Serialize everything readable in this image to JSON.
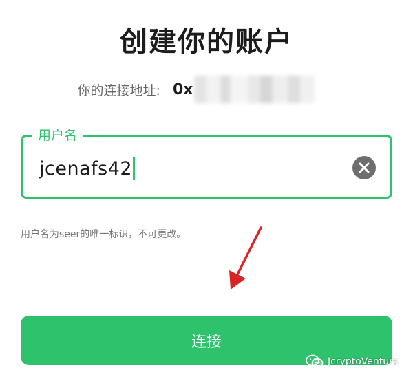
{
  "page": {
    "title": "创建你的账户"
  },
  "address": {
    "label": "你的连接地址:",
    "value_prefix": "0x"
  },
  "username_field": {
    "label": "用户名",
    "value": "jcenafs42"
  },
  "helper_text": "用户名为seer的唯一标识，不可更改。",
  "connect_button": {
    "label": "连接"
  },
  "watermark": {
    "text": "JcryptoVenturs"
  },
  "colors": {
    "accent": "#2ec26c",
    "arrow": "#d92424",
    "clear_icon_bg": "#6e6e6e"
  },
  "icons": {
    "clear": "clear-icon",
    "arrow": "arrow-annotation-icon",
    "watermark": "wechat-icon"
  }
}
